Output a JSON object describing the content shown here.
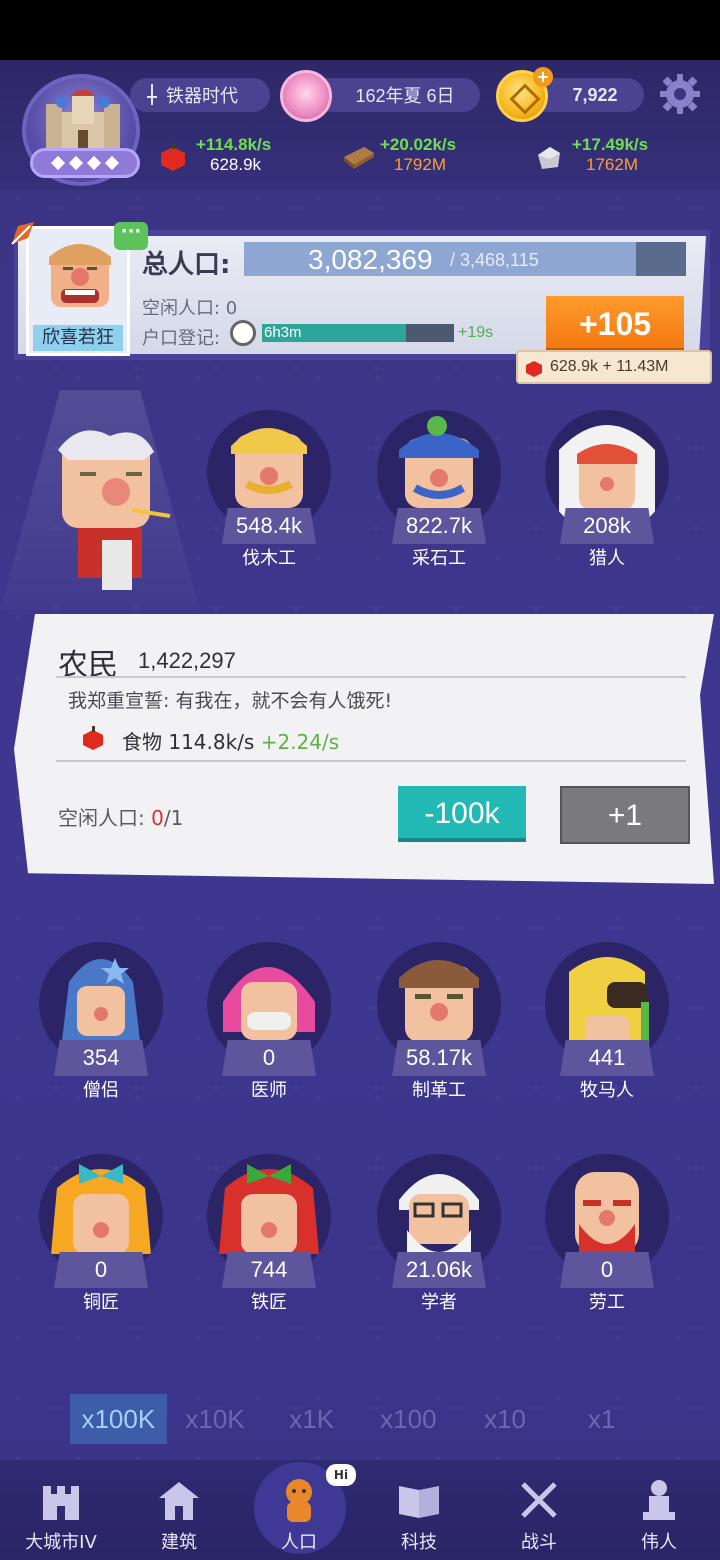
{
  "hud": {
    "era": "铁器时代",
    "date": "162年夏 6日",
    "coins": "7,922",
    "food": {
      "rate": "+114.8k/s",
      "amount": "628.9k"
    },
    "wood": {
      "rate": "+20.02k/s",
      "amount": "1792M"
    },
    "stone": {
      "rate": "+17.49k/s",
      "amount": "1762M"
    }
  },
  "population": {
    "advisor_tag": "欣喜若狂",
    "label": "总人口:",
    "total": "3,082,369",
    "max": "/ 3,468,115",
    "fill_fraction": 0.888,
    "idle_label": "空闲人口: 0",
    "registration_label": "户口登记:",
    "registration_time": "6h3m",
    "registration_fill_fraction": 0.75,
    "registration_bonus": "+19s",
    "add_button": "+105",
    "cost": "628.9k + 11.43M"
  },
  "top_jobs": [
    {
      "name": "伐木工",
      "count": "548.4k"
    },
    {
      "name": "采石工",
      "count": "822.7k"
    },
    {
      "name": "猎人",
      "count": "208k"
    }
  ],
  "detail": {
    "title": "农民",
    "count": "1,422,297",
    "quote": "我郑重宣誓: 有我在，就不会有人饿死!",
    "product": "食物 114.8k/s",
    "product_bonus": "+2.24/s",
    "idle_label": "空闲人口: ",
    "idle_value": "0",
    "idle_max": "/1",
    "minus_button": "-100k",
    "plus_button": "+1"
  },
  "jobs_row1": [
    {
      "name": "僧侣",
      "count": "354"
    },
    {
      "name": "医师",
      "count": "0"
    },
    {
      "name": "制革工",
      "count": "58.17k"
    },
    {
      "name": "牧马人",
      "count": "441"
    }
  ],
  "jobs_row2": [
    {
      "name": "铜匠",
      "count": "0"
    },
    {
      "name": "铁匠",
      "count": "744"
    },
    {
      "name": "学者",
      "count": "21.06k"
    },
    {
      "name": "劳工",
      "count": "0"
    }
  ],
  "multipliers": [
    "x100K",
    "x10K",
    "x1K",
    "x100",
    "x10",
    "x1"
  ],
  "nav": {
    "city": "大城市IV",
    "build": "建筑",
    "people": "人口",
    "tech": "科技",
    "battle": "战斗",
    "greats": "伟人",
    "hi_badge": "Hi"
  },
  "colors": {
    "background": "#3b3482",
    "accent_orange": "#f27a12",
    "accent_teal": "#22b9b4",
    "rate_green": "#6be04d"
  }
}
